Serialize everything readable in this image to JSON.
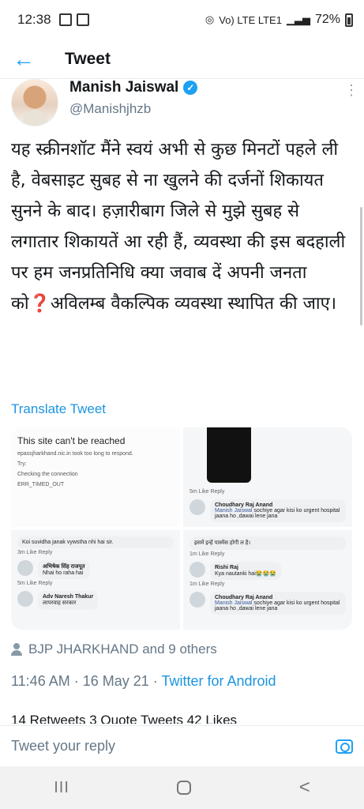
{
  "status_bar": {
    "time": "12:38",
    "network": "Vo) LTE LTE1",
    "battery": "72%"
  },
  "header": {
    "back_icon": "arrow-left-icon",
    "title": "Tweet"
  },
  "author": {
    "name": "Manish Jaiswal",
    "handle": "@Manishjhzb",
    "verified": true
  },
  "tweet": {
    "text": "यह स्क्रीनशॉट मैंने स्वयं अभी से कुछ मिनटों पहले ली है, वेबसाइट सुबह से ना खुलने की दर्जनों शिकायत सुनने के बाद। हज़ारीबाग जिले से मुझे सुबह से लगातार शिकायतें आ रही हैं, व्यवस्था की इस बदहाली पर हम जनप्रतिनिधि क्या जवाब दें अपनी जनता को❓अविलम्ब वैकल्पिक व्यवस्था स्थापित की जाए।",
    "translate_label": "Translate Tweet"
  },
  "media": {
    "img1": {
      "title": "This site can't be reached",
      "url_line": "epassjharkhand.nic.in took too long to respond.",
      "try": "Try:",
      "check": "Checking the connection",
      "err": "ERR_TIMED_OUT"
    },
    "img2": {
      "meta": "5m   Like   Reply",
      "commenter": "Choudhary Raj Anand",
      "mention": "Manish Jaiswal",
      "comment": "sochiye agar kisi ko urgent hospital jaana ho ,dawai lene jana"
    },
    "img3": {
      "c1": "Koi suvidha janak vywstha nhi hai sir.",
      "m1": "3m   Like   Reply",
      "n2": "अभिषेक सिंह राजपूत",
      "c2": "Nhai ho raha hai",
      "m2": "5m   Like   Reply",
      "n3": "Adv Naresh Thakur",
      "c3": "लापरवाह सरकार"
    },
    "img4": {
      "c1": "इसमें इन्हें पास्मेंस होगी ल है।",
      "m1": "1m   Like   Reply",
      "n2": "Rishi Raj",
      "c2": "Kya nautanki hai😭😭😭",
      "m2": "1m   Like   Reply",
      "n3": "Choudhary Raj Anand",
      "mention": "Manish Jaiswal",
      "c3": "sochiye agar kisi ko urgent hospital jaana ho ,dawai lene jana"
    }
  },
  "liked_by": "BJP JHARKHAND and 9 others",
  "timestamp": {
    "time": "11:46 AM · 16 May 21 · ",
    "source": "Twitter for Android"
  },
  "stats": "14 Retweets   3 Quote Tweets   42 Likes",
  "reply": {
    "placeholder": "Tweet your reply",
    "camera_icon": "camera-icon"
  },
  "nav": {
    "recent": "III",
    "home": "home-icon",
    "back": "<"
  }
}
